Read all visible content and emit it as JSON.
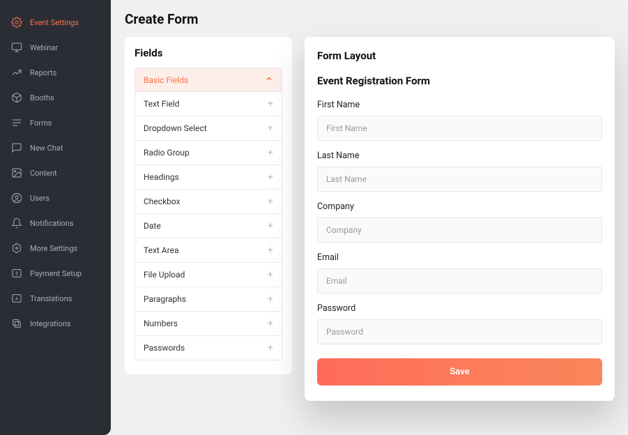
{
  "sidebar": {
    "items": [
      {
        "label": "Event Settings",
        "icon": "gear"
      },
      {
        "label": "Webinar",
        "icon": "monitor"
      },
      {
        "label": "Reports",
        "icon": "chart"
      },
      {
        "label": "Booths",
        "icon": "cube"
      },
      {
        "label": "Forms",
        "icon": "lines"
      },
      {
        "label": "New Chat",
        "icon": "chat"
      },
      {
        "label": "Content",
        "icon": "image"
      },
      {
        "label": "Users",
        "icon": "user"
      },
      {
        "label": "Notifications",
        "icon": "bell"
      },
      {
        "label": "More Settings",
        "icon": "hex"
      },
      {
        "label": "Payment Setup",
        "icon": "dollar"
      },
      {
        "label": "Translations",
        "icon": "lang"
      },
      {
        "label": "Integrations",
        "icon": "layers"
      }
    ]
  },
  "page": {
    "title": "Create Form"
  },
  "fields_panel": {
    "title": "Fields",
    "group_label": "Basic Fields",
    "items": [
      "Text Field",
      "Dropdown Select",
      "Radio Group",
      "Headings",
      "Checkbox",
      "Date",
      "Text Area",
      "File Upload",
      "Paragraphs",
      "Numbers",
      "Passwords"
    ]
  },
  "layout_panel": {
    "title": "Form Layout",
    "form_title": "Event Registration Form",
    "fields": [
      {
        "label": "First Name",
        "placeholder": "First Name"
      },
      {
        "label": "Last Name",
        "placeholder": "Last Name"
      },
      {
        "label": "Company",
        "placeholder": "Company"
      },
      {
        "label": "Email",
        "placeholder": "Email"
      },
      {
        "label": "Password",
        "placeholder": "Password"
      }
    ],
    "save_label": "Save"
  }
}
